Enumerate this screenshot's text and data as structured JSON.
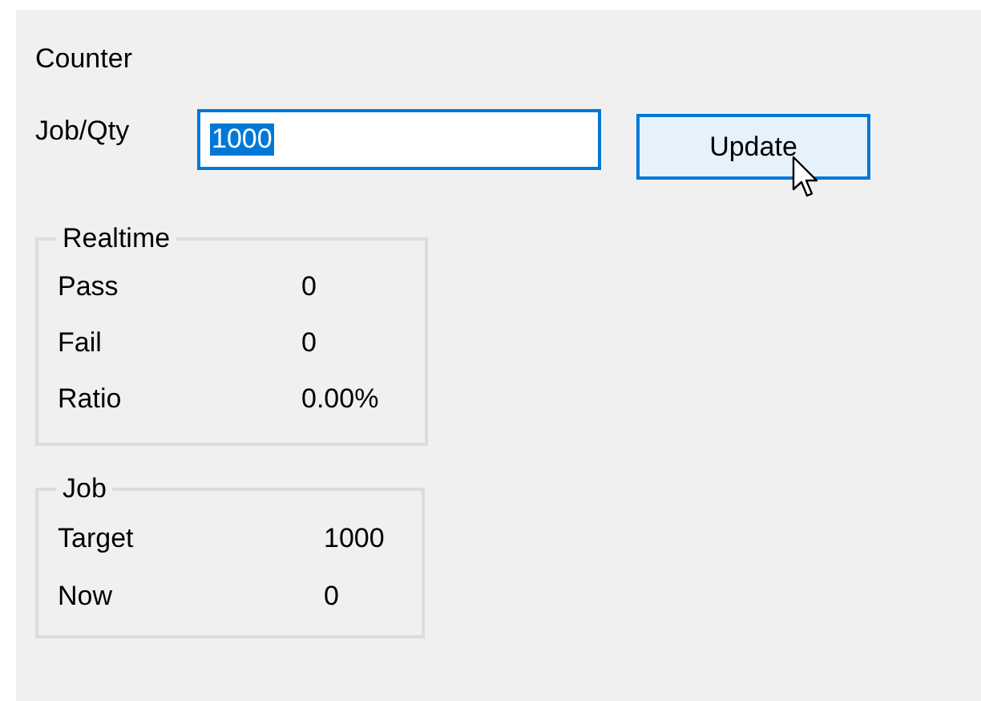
{
  "title": "Counter",
  "job_qty": {
    "label": "Job/Qty",
    "value": "1000",
    "text_selected": true
  },
  "update_button": {
    "label": "Update",
    "hovered": true
  },
  "groups": [
    {
      "title": "Realtime",
      "rows": [
        {
          "label": "Pass",
          "value": "0"
        },
        {
          "label": "Fail",
          "value": "0"
        },
        {
          "label": "Ratio",
          "value": "0.00%"
        }
      ]
    },
    {
      "title": "Job",
      "rows": [
        {
          "label": "Target",
          "value": "1000"
        },
        {
          "label": "Now",
          "value": "0"
        }
      ]
    }
  ]
}
